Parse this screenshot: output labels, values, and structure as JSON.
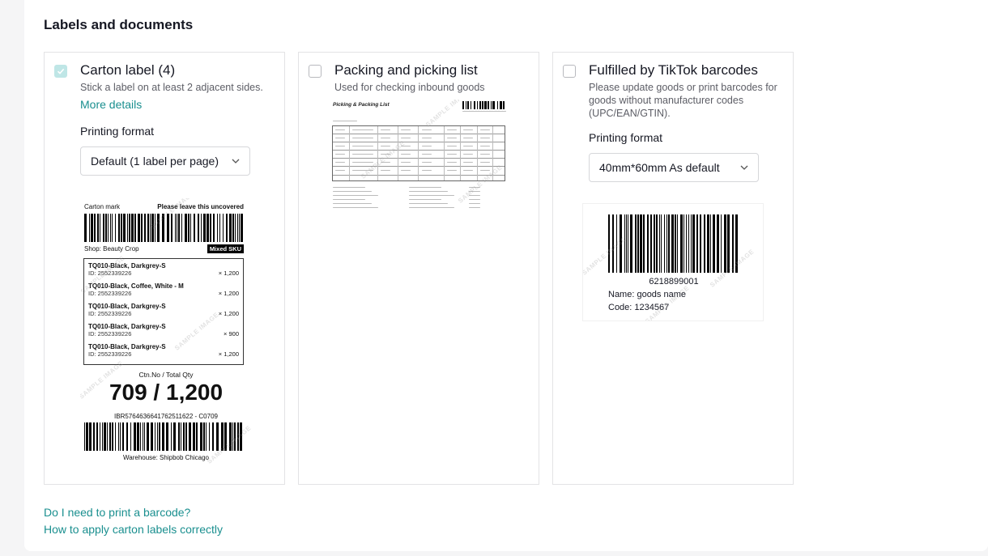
{
  "section": {
    "title": "Labels and documents"
  },
  "cards": [
    {
      "title": "Carton label (4)",
      "checked": true,
      "description": "Stick a label on at least 2 adjacent sides.",
      "link": "More details",
      "format_label": "Printing format",
      "format_value": "Default (1 label per page)",
      "preview": {
        "carton_mark": "Carton mark",
        "uncovered": "Please leave this uncovered",
        "shop": "Shop: Beauty Crop",
        "mixed": "Mixed SKU",
        "items": [
          {
            "name": "TQ010-Black, Darkgrey-S",
            "id": "ID: 2552339226",
            "qty": "× 1,200"
          },
          {
            "name": "TQ010-Black, Coffee, White - M",
            "id": "ID: 2552339226",
            "qty": "× 1,200"
          },
          {
            "name": "TQ010-Black, Darkgrey-S",
            "id": "ID: 2552339226",
            "qty": "× 1,200"
          },
          {
            "name": "TQ010-Black, Darkgrey-S",
            "id": "ID: 2552339226",
            "qty": "× 900"
          },
          {
            "name": "TQ010-Black, Darkgrey-S",
            "id": "ID: 2552339226",
            "qty": "× 1,200"
          }
        ],
        "ctn_label": "Ctn.No / Total Qty",
        "ctn_value": "709 / 1,200",
        "code": "IBR5764636641762511622 - C0709",
        "warehouse": "Warehouse: Shipbob Chicago"
      }
    },
    {
      "title": "Packing and picking list",
      "checked": false,
      "description": "Used for checking inbound goods",
      "preview": {
        "heading": "Picking & Packing List"
      }
    },
    {
      "title": "Fulfilled by TikTok barcodes",
      "checked": false,
      "description": "Please update goods or print barcodes for goods without manufacturer codes (UPC/EAN/GTIN).",
      "format_label": "Printing format",
      "format_value": "40mm*60mm As default",
      "preview": {
        "number": "6218899001",
        "name": "Name: goods name",
        "code": "Code: 1234567"
      }
    }
  ],
  "watermark": "SAMPLE IMAGE",
  "footer": {
    "link1": "Do I need to print a barcode?",
    "link2": "How to apply carton labels correctly"
  },
  "colors": {
    "link": "#1a8f8f",
    "check": "#bfe6e6",
    "border": "#e3e3e5"
  }
}
